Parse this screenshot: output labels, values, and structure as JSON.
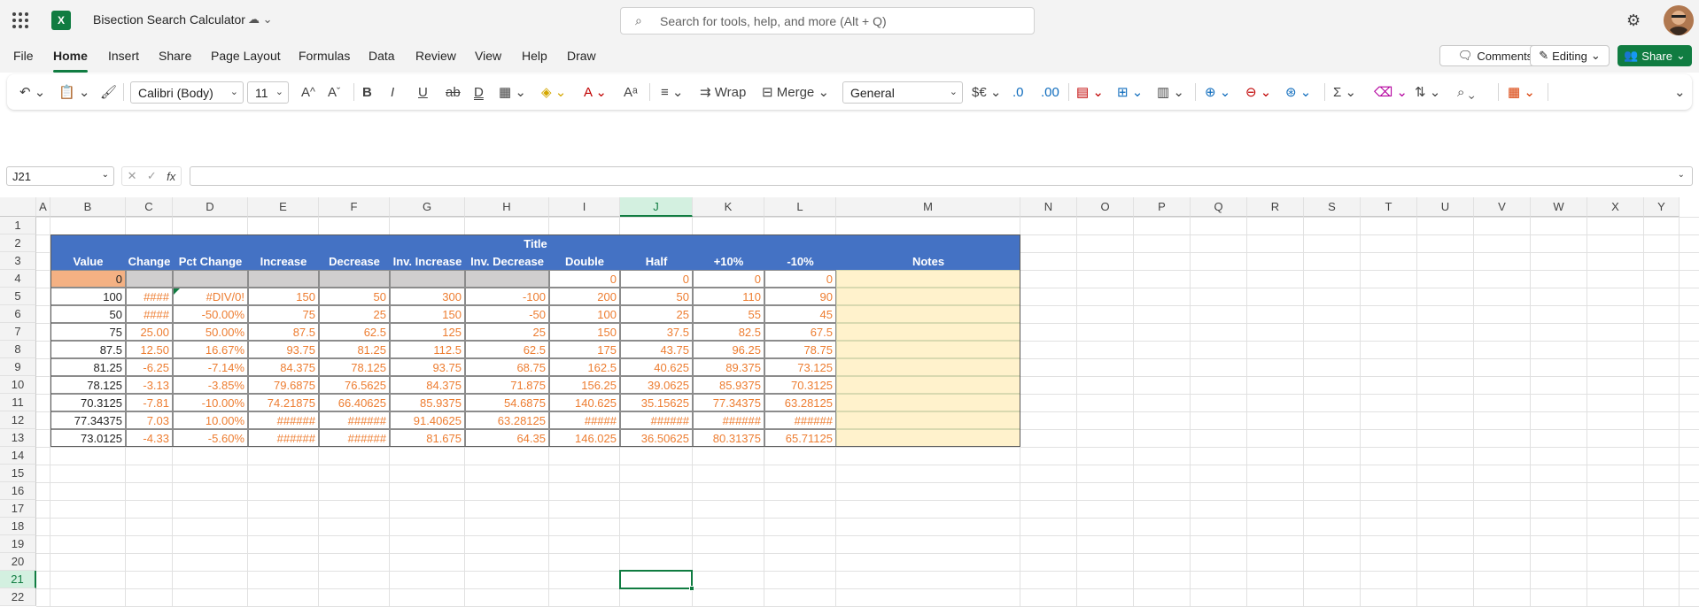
{
  "app": {
    "doc_title": "Bisection Search Calculator",
    "search_placeholder": "Search for tools, help, and more (Alt + Q)",
    "logo": "X"
  },
  "menu": [
    "File",
    "Home",
    "Insert",
    "Share",
    "Page Layout",
    "Formulas",
    "Data",
    "Review",
    "View",
    "Help",
    "Draw"
  ],
  "active_menu": "Home",
  "actions": {
    "comments": "Comments",
    "editing": "Editing",
    "share": "Share"
  },
  "ribbon": {
    "font": "Calibri (Body)",
    "size": "11",
    "wrap": "Wrap",
    "merge": "Merge",
    "number_format": "General"
  },
  "formula_bar": {
    "name_box": "J21",
    "formula": ""
  },
  "columns": [
    "A",
    "B",
    "C",
    "D",
    "E",
    "F",
    "G",
    "H",
    "I",
    "J",
    "K",
    "L",
    "M",
    "N",
    "O",
    "P",
    "Q",
    "R",
    "S",
    "T",
    "U",
    "V",
    "W",
    "X",
    "Y"
  ],
  "rows": [
    "1",
    "2",
    "3",
    "4",
    "5",
    "6",
    "7",
    "8",
    "9",
    "10",
    "11",
    "12",
    "13",
    "14",
    "15",
    "16",
    "17",
    "18",
    "19",
    "20",
    "21",
    "22"
  ],
  "selected_cell": {
    "col": "J",
    "row": "21"
  },
  "table": {
    "title": "Title",
    "headers": [
      "Value",
      "Change",
      "Pct Change",
      "Increase",
      "Decrease",
      "Inv. Increase",
      "Inv. Decrease",
      "Double",
      "Half",
      "+10%",
      "-10%",
      "Notes"
    ],
    "rows": [
      [
        "0",
        "",
        "",
        "",
        "",
        "",
        "",
        "0",
        "0",
        "0",
        "0",
        ""
      ],
      [
        "100",
        "####",
        "#DIV/0!",
        "150",
        "50",
        "300",
        "-100",
        "200",
        "50",
        "110",
        "90",
        ""
      ],
      [
        "50",
        "####",
        "-50.00%",
        "75",
        "25",
        "150",
        "-50",
        "100",
        "25",
        "55",
        "45",
        ""
      ],
      [
        "75",
        "25.00",
        "50.00%",
        "87.5",
        "62.5",
        "125",
        "25",
        "150",
        "37.5",
        "82.5",
        "67.5",
        ""
      ],
      [
        "87.5",
        "12.50",
        "16.67%",
        "93.75",
        "81.25",
        "112.5",
        "62.5",
        "175",
        "43.75",
        "96.25",
        "78.75",
        ""
      ],
      [
        "81.25",
        "-6.25",
        "-7.14%",
        "84.375",
        "78.125",
        "93.75",
        "68.75",
        "162.5",
        "40.625",
        "89.375",
        "73.125",
        ""
      ],
      [
        "78.125",
        "-3.13",
        "-3.85%",
        "79.6875",
        "76.5625",
        "84.375",
        "71.875",
        "156.25",
        "39.0625",
        "85.9375",
        "70.3125",
        ""
      ],
      [
        "70.3125",
        "-7.81",
        "-10.00%",
        "74.21875",
        "66.40625",
        "85.9375",
        "54.6875",
        "140.625",
        "35.15625",
        "77.34375",
        "63.28125",
        ""
      ],
      [
        "77.34375",
        "7.03",
        "10.00%",
        "######",
        "######",
        "91.40625",
        "63.28125",
        "#####",
        "######",
        "######",
        "######",
        ""
      ],
      [
        "73.0125",
        "-4.33",
        "-5.60%",
        "######",
        "######",
        "81.675",
        "64.35",
        "146.025",
        "36.50625",
        "80.31375",
        "65.71125",
        ""
      ]
    ]
  },
  "colors": {
    "header_blue": "#4472c4",
    "value_orange": "#ed7d31",
    "input_fill": "#f4b183",
    "gray_fill": "#d0cece",
    "notes_fill": "#fff2cc",
    "excel_green": "#107c41"
  }
}
